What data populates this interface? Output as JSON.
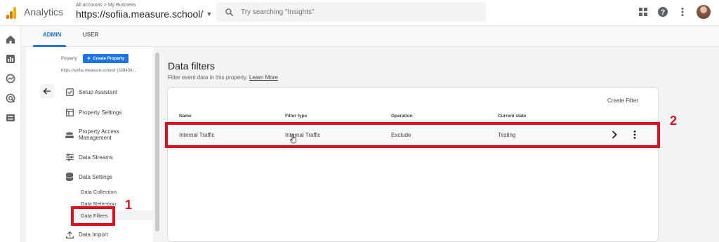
{
  "app": {
    "name": "Analytics",
    "logo_colors": [
      "#f9ab00",
      "#e37400",
      "#e37400"
    ]
  },
  "breadcrumb": {
    "account": "All accounts",
    "separator": ">",
    "business": "My Business"
  },
  "property_switcher": {
    "label": "https://sofiia.measure.school/"
  },
  "search": {
    "placeholder": "Try searching \"Insights\""
  },
  "header_icons": [
    "apps-icon",
    "help-icon",
    "more-vert-icon",
    "avatar"
  ],
  "rail_icons": [
    "home-icon",
    "reports-icon",
    "explore-icon",
    "advertising-icon",
    "configure-icon"
  ],
  "tabs": [
    {
      "label": "ADMIN",
      "active": true
    },
    {
      "label": "USER",
      "active": false
    }
  ],
  "admin_panel": {
    "property_label": "Property",
    "create_property_label": "Create Property",
    "property_url": "https://sofiia.measure.school/ (328434...",
    "nav": [
      {
        "label": "Setup Assistant",
        "icon": "checkbox-icon"
      },
      {
        "label": "Property Settings",
        "icon": "settings-window-icon"
      },
      {
        "label": "Property Access Management",
        "icon": "people-icon"
      },
      {
        "label": "Data Streams",
        "icon": "streams-icon"
      },
      {
        "label": "Data Settings",
        "icon": "database-icon"
      },
      {
        "label": "Data Import",
        "icon": "upload-icon"
      }
    ],
    "data_settings_sub": [
      "Data Collection",
      "Data Retention",
      "Data Filters"
    ],
    "selected": "Data Filters"
  },
  "content": {
    "title": "Data filters",
    "subtitle": "Filter event data in this property.",
    "learn_more": "Learn More",
    "create_filter": "Create Filter",
    "columns": [
      "Name",
      "Filter type",
      "Operation",
      "Current state"
    ],
    "rows": [
      {
        "name": "Internal Traffic",
        "filter_type": "Internal Traffic",
        "operation": "Exclude",
        "state": "Testing"
      }
    ]
  },
  "annotations": {
    "marker_1": "1",
    "marker_2": "2",
    "color": "#e0101e"
  },
  "colors": {
    "accent": "#1a73e8",
    "highlight": "#e0101e",
    "canvas": "#f1f3f4"
  }
}
